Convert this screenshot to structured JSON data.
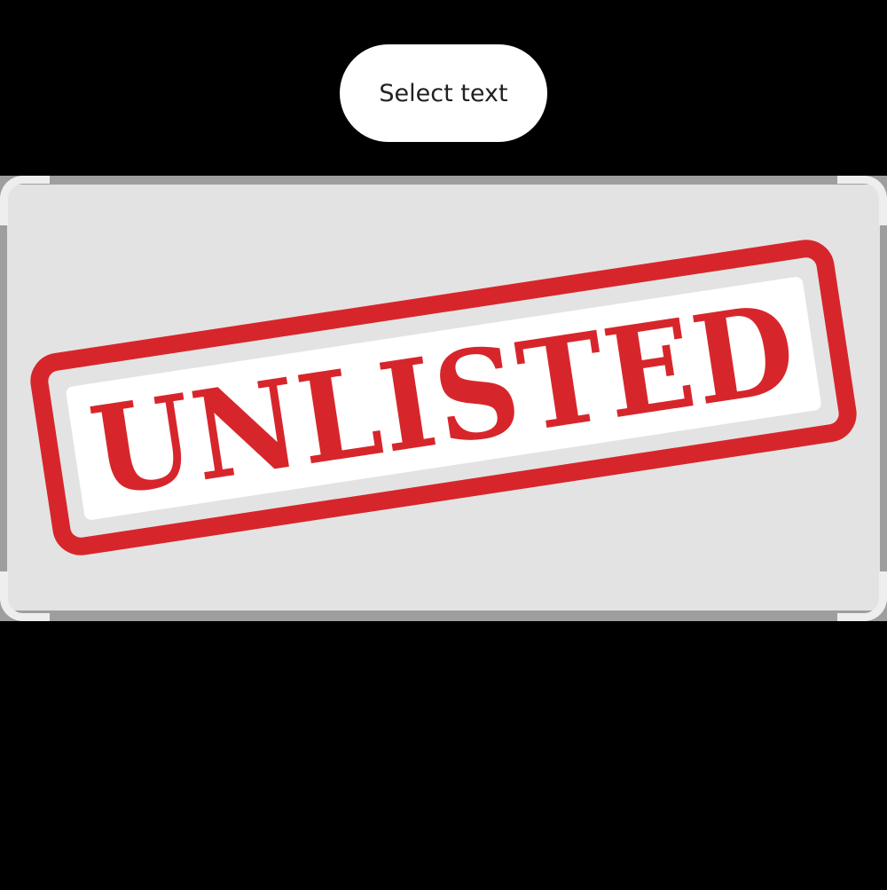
{
  "toolbar": {
    "select_text_label": "Select text"
  },
  "image": {
    "stamp_text": "UNLISTED"
  },
  "colors": {
    "background": "#000000",
    "panel_background": "#e3e3e3",
    "stamp_red": "#d7262b",
    "stamp_inner": "#ffffff",
    "button_background": "#ffffff"
  },
  "icons": {
    "crop_corners": "crop-corner-handle-icon"
  }
}
